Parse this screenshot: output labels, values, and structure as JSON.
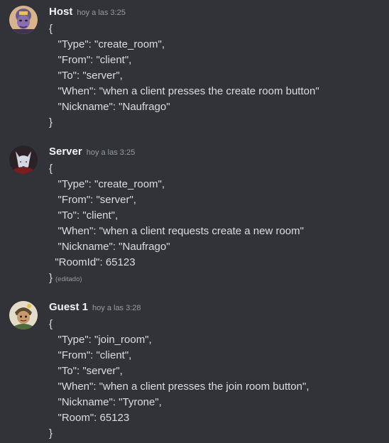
{
  "messages": [
    {
      "username": "Host",
      "timestamp": "hoy a las 3:25",
      "lines": [
        "{",
        "   \"Type\": \"create_room\",",
        "   \"From\": \"client\",",
        "   \"To\": \"server\",",
        "   \"When\": \"when a client presses the create room button\"",
        "   \"Nickname\": \"Naufrago\"",
        "}"
      ],
      "edited": ""
    },
    {
      "username": "Server",
      "timestamp": "hoy a las 3:25",
      "lines": [
        "{",
        "   \"Type\": \"create_room\",",
        "   \"From\": \"server\",",
        "   \"To\": \"client\",",
        "   \"When\": \"when a client requests create a new room\"",
        "   \"Nickname\": \"Naufrago\"",
        "  \"RoomId\": 65123",
        "}"
      ],
      "edited": "(editado)"
    },
    {
      "username": "Guest 1",
      "timestamp": "hoy a las 3:28",
      "lines": [
        "{",
        "   \"Type\": \"join_room\",",
        "   \"From\": \"client\",",
        "   \"To\": \"server\",",
        "   \"When\": \"when a client presses the join room button\",",
        "   \"Nickname\": \"Tyrone\",",
        "   \"Room\": 65123",
        "}"
      ],
      "edited": ""
    }
  ],
  "avatars": [
    "host-avatar-icon",
    "server-wolf-avatar-icon",
    "guest-avatar-icon"
  ],
  "colors": {
    "background": "#313338",
    "username": "#f2f3f5",
    "text": "#dbdee1",
    "muted": "#949ba4"
  }
}
